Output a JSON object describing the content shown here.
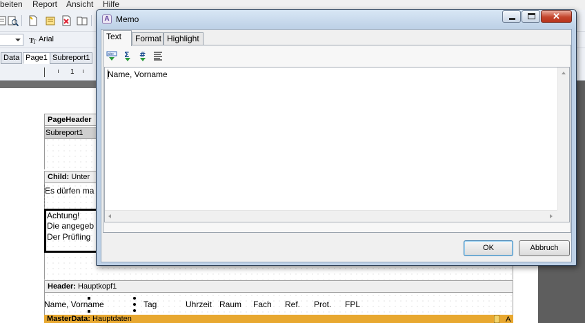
{
  "designer": {
    "menu": [
      "beiten",
      "Report",
      "Ansicht",
      "Hilfe"
    ],
    "font_name": "Arial",
    "tabs": [
      "Data",
      "Page1",
      "Subreport1"
    ],
    "ruler_number": "1",
    "page_header": {
      "name": "PageHeader"
    },
    "subreport_label": "Subreport1",
    "child_band": {
      "name": "Child:",
      "value": "Unter"
    },
    "child_text": "Es dürfen ma",
    "achtung_lines": [
      "Achtung!",
      "Die angegeb",
      "Der Prüfling"
    ],
    "header_band": {
      "name": "Header:",
      "value": "Hauptkopf1"
    },
    "header_fields": [
      "Name, Vorname",
      "Tag",
      "Uhrzeit",
      "Raum",
      "Fach",
      "Ref.",
      "Prot.",
      "FPL"
    ],
    "masterdata_band": {
      "name": "MasterData:",
      "value": "Hauptdaten"
    },
    "masterdata_suffix": "A"
  },
  "memo_dialog": {
    "title": "Memo",
    "close_symbol": "✕",
    "tabs": [
      "Text",
      "Format",
      "Highlight"
    ],
    "active_tab": "Text",
    "toolbar_icons": [
      "insert-data-field-icon",
      "aggregate-sum-icon",
      "number-format-icon",
      "text-align-icon"
    ],
    "text": "Name, Vorname",
    "ok_label": "OK",
    "cancel_label": "Abbruch"
  },
  "colors": {
    "masterdata_band": "#e8a830",
    "dialog_frame": "#bdd0e6",
    "close_button": "#c4452d"
  }
}
